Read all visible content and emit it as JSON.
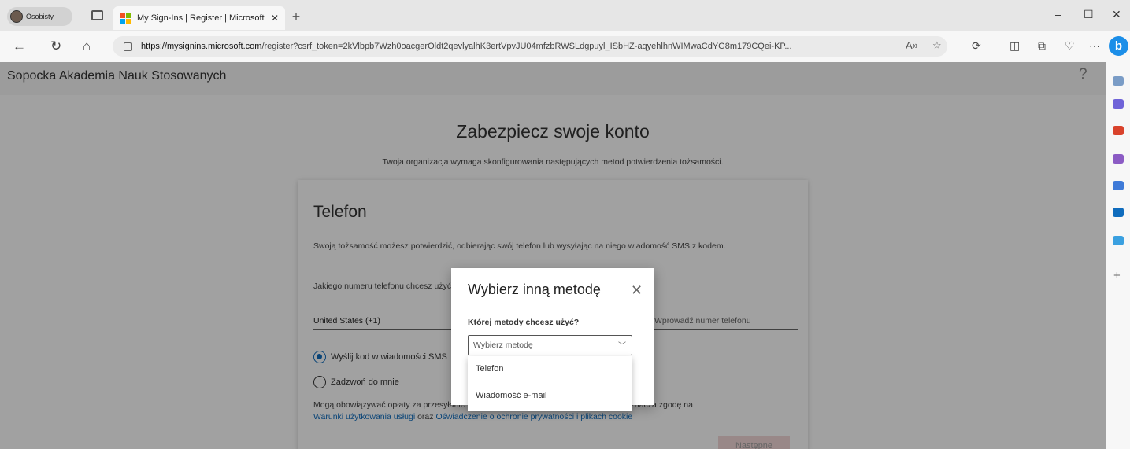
{
  "browser": {
    "profile_label": "Osobisty",
    "tab_title": "My Sign-Ins | Register | Microsoft",
    "tab_close": "✕",
    "new_tab": "+",
    "minimize": "‒",
    "maximize": "☐",
    "close": "✕",
    "url_host": "https://mysignins.microsoft.com",
    "url_path": "/register?csrf_token=2kVlbpb7Wzh0oacgerOldt2qevlyalhK3ertVpvJU04mfzbRWSLdgpuyl_ISbHZ-aqyehlhnWIMwaCdYG8m179CQei-KP...",
    "read_aloud": "A»",
    "favorite": "☆",
    "more": "···",
    "bing_label": "b"
  },
  "header": {
    "org_name": "Sopocka Akademia Nauk Stosowanych",
    "help": "?"
  },
  "main": {
    "title": "Zabezpiecz swoje konto",
    "subtitle": "Twoja organizacja wymaga skonfigurowania następujących metod potwierdzenia tożsamości."
  },
  "card": {
    "title": "Telefon",
    "description": "Swoją tożsamość możesz potwierdzić, odbierając swój telefon lub wysyłając na niego wiadomość SMS z kodem.",
    "question": "Jakiego numeru telefonu chcesz użyć?",
    "country_value": "United States (+1)",
    "phone_placeholder": "Wprowadź numer telefonu",
    "radio_sms": "Wyślij kod w wiadomości SMS",
    "radio_sms_selected": true,
    "radio_call": "Zadzwoń do mnie",
    "fees_text": "Mogą obowiązywać opłaty za przesyłanie wiadomości i danych. Wybranie opcji Dalej oznacza zgodę na",
    "terms_link": "Warunki użytkowania usługi",
    "and_text": " oraz ",
    "privacy_link": "Oświadczenie o ochronie prywatności i plikach cookie",
    "next_button": "Następne"
  },
  "dialog": {
    "title": "Wybierz inną metodę",
    "close": "✕",
    "label": "Której metody chcesz użyć?",
    "select_placeholder": "Wybierz metodę",
    "options": [
      "Telefon",
      "Wiadomość e-mail"
    ]
  },
  "colors": {
    "accent": "#0f6cbd",
    "bing": "#1b8ee8",
    "overlay": "rgba(0,0,0,0.37)"
  }
}
